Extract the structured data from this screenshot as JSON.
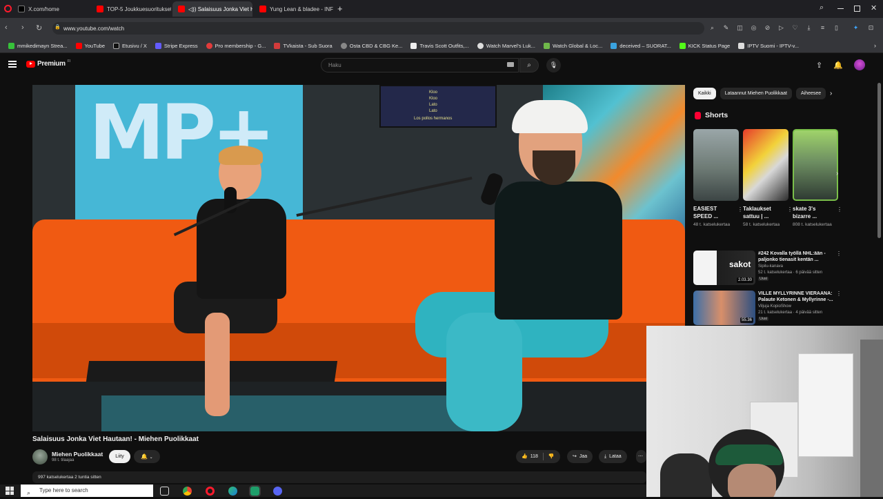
{
  "browser": {
    "tabs": [
      {
        "label": "X.com/home",
        "active": false
      },
      {
        "label": "TOP-5 Joukkuesuoritukset",
        "active": false
      },
      {
        "label": "◁)) Salaisuus Jonka Viet H",
        "active": true
      },
      {
        "label": "Yung Lean & bladee - INF",
        "active": false
      }
    ],
    "url": "www.youtube.com/watch"
  },
  "bookmarks": [
    {
      "label": "mmikedimayn Strea...",
      "color": "#37c23a"
    },
    {
      "label": "YouTube",
      "color": "#ff0000"
    },
    {
      "label": "Etusivu / X",
      "color": "#dddddd"
    },
    {
      "label": "Stripe Express",
      "color": "#635bff"
    },
    {
      "label": "Pro membership - G...",
      "color": "#e23b3b"
    },
    {
      "label": "TVkaista - Sub Suora",
      "color": "#d23b3b"
    },
    {
      "label": "Osta CBD & CBG Ke...",
      "color": "#888888"
    },
    {
      "label": "Travis Scott Outfits,...",
      "color": "#eeeeee"
    },
    {
      "label": "Watch Marvel's Luk...",
      "color": "#dddddd"
    },
    {
      "label": "Watch Global & Loc...",
      "color": "#6fb84a"
    },
    {
      "label": "deceived – SUORAT...",
      "color": "#3aa3e0"
    },
    {
      "label": "KICK Status Page",
      "color": "#53fc18"
    },
    {
      "label": "IPTV Suomi - IPTV-v...",
      "color": "#dddddd"
    }
  ],
  "youtube": {
    "logo_text": "Premium",
    "logo_region": "FI",
    "search_placeholder": "Haku"
  },
  "video": {
    "title": "Salaisuus Jonka Viet Hautaan! - Miehen Puolikkaat",
    "channel": "Miehen Puolikkaat",
    "subscribers": "98 t. tilaajaa",
    "join_label": "Liity",
    "likes": "118",
    "share_label": "Jaa",
    "download_label": "Lataa",
    "description_meta": "997 katselukertaa  2 tuntia sitten"
  },
  "sidebar": {
    "chips": [
      {
        "label": "Kaikki",
        "active": true
      },
      {
        "label": "Lataannut Miehen Puolikkaat",
        "active": false
      },
      {
        "label": "Aiheesee",
        "active": false
      }
    ],
    "shorts_heading": "Shorts",
    "shorts": [
      {
        "title_line1": "EASIEST",
        "title_line2": "SPEED ...",
        "views": "48 t. katselukertaa"
      },
      {
        "title_line1": "Taklaukset",
        "title_line2": "sattuu | ...",
        "views": "58 t. katselukertaa"
      },
      {
        "title_line1": "skate 3's",
        "title_line2": "bizarre ...",
        "views": "808 t. katselukertaa"
      }
    ],
    "recommended": [
      {
        "title": "#242 Kovalla työllä NHL:ään - paljonko tienasit kentän ...",
        "channel": "Sipilu-kanava",
        "meta": "52 t. katselukertaa · 6 päivää sitten",
        "badge": "Uusi",
        "duration": "2.03.30",
        "thumb_text": "sakot"
      },
      {
        "title": "VILLE MYLLYRINNE VIERAANA: Palaute Ketonen & Myllyrinne -...",
        "channel": "Viljuja KopioShow",
        "meta": "21 t. katselukertaa · 4 päivää sitten",
        "badge": "Uusi",
        "duration": "55.36"
      }
    ]
  },
  "taskbar": {
    "search_placeholder": "Type here to search"
  },
  "player_scene": {
    "poster_text": "MP+",
    "screen_lines": [
      "Kloo",
      "Kloo",
      "Lato",
      "Lato",
      "Los pollos hermanos"
    ]
  }
}
